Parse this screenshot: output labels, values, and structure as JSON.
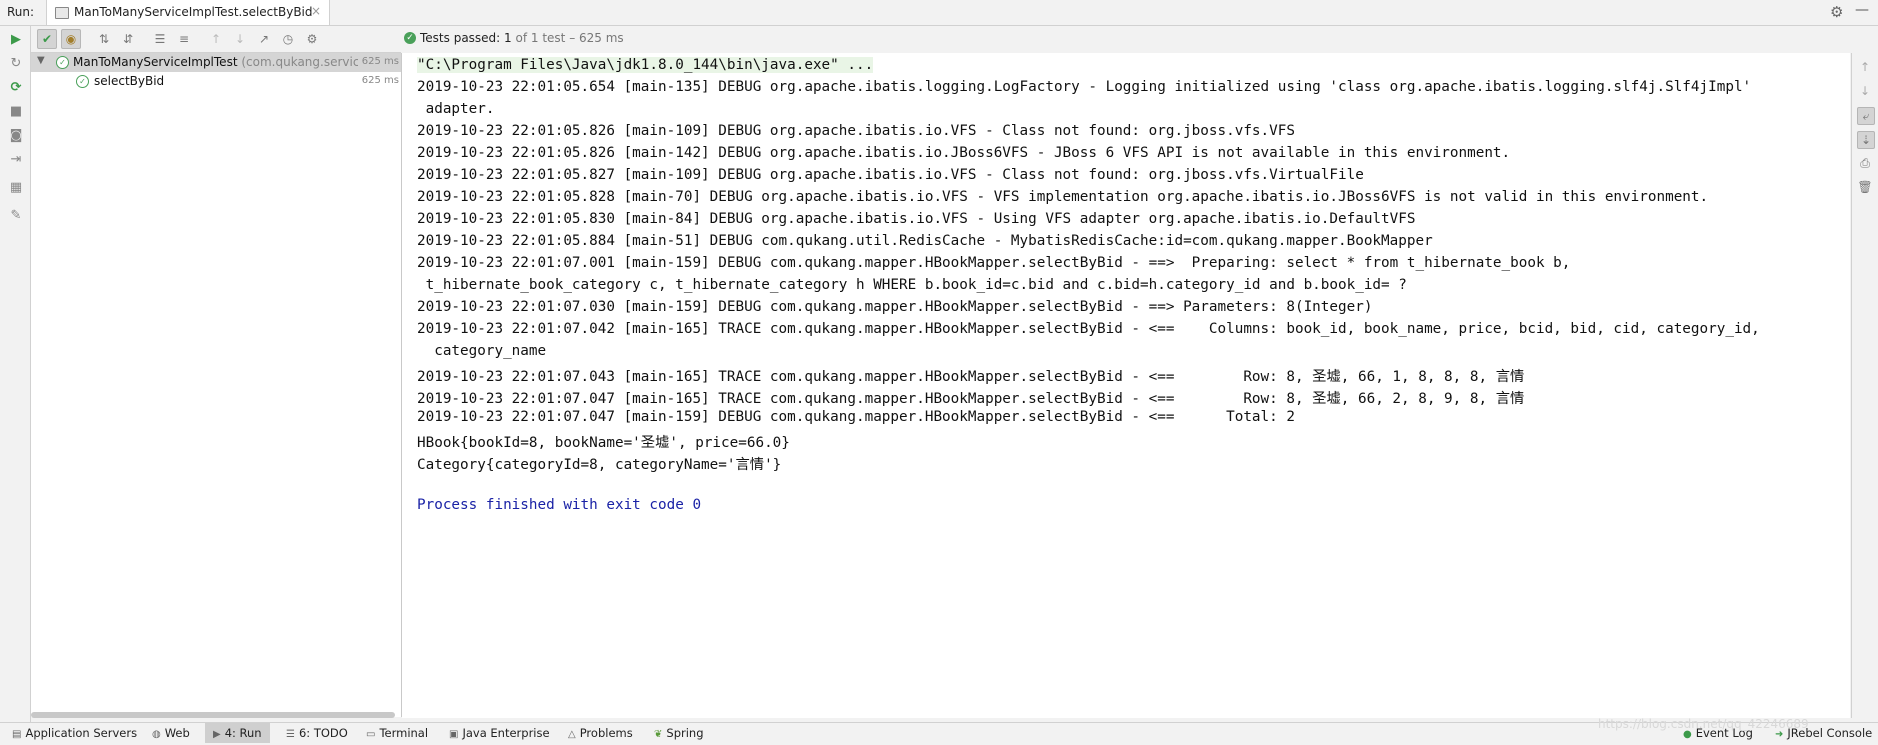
{
  "run_header": {
    "label": "Run:",
    "tab_title": "ManToManyServiceImplTest.selectByBid",
    "tab_close": "×"
  },
  "tests_status": {
    "passed_text": "Tests passed: 1",
    "detail_text": "of 1 test – 625 ms"
  },
  "tree": {
    "root": {
      "name": "ManToManyServiceImplTest",
      "package": "(com.qukang.service",
      "duration": "625 ms"
    },
    "child": {
      "name": "selectByBid",
      "duration": "625 ms"
    }
  },
  "console": {
    "lines": [
      "\"C:\\Program Files\\Java\\jdk1.8.0_144\\bin\\java.exe\" ...",
      "2019-10-23 22:01:05.654 [main-135] DEBUG org.apache.ibatis.logging.LogFactory - Logging initialized using 'class org.apache.ibatis.logging.slf4j.Slf4jImpl'",
      " adapter.",
      "2019-10-23 22:01:05.826 [main-109] DEBUG org.apache.ibatis.io.VFS - Class not found: org.jboss.vfs.VFS",
      "2019-10-23 22:01:05.826 [main-142] DEBUG org.apache.ibatis.io.JBoss6VFS - JBoss 6 VFS API is not available in this environment.",
      "2019-10-23 22:01:05.827 [main-109] DEBUG org.apache.ibatis.io.VFS - Class not found: org.jboss.vfs.VirtualFile",
      "2019-10-23 22:01:05.828 [main-70] DEBUG org.apache.ibatis.io.VFS - VFS implementation org.apache.ibatis.io.JBoss6VFS is not valid in this environment.",
      "2019-10-23 22:01:05.830 [main-84] DEBUG org.apache.ibatis.io.VFS - Using VFS adapter org.apache.ibatis.io.DefaultVFS",
      "2019-10-23 22:01:05.884 [main-51] DEBUG com.qukang.util.RedisCache - MybatisRedisCache:id=com.qukang.mapper.BookMapper",
      "2019-10-23 22:01:07.001 [main-159] DEBUG com.qukang.mapper.HBookMapper.selectByBid - ==>  Preparing: select * from t_hibernate_book b,",
      " t_hibernate_book_category c, t_hibernate_category h WHERE b.book_id=c.bid and c.bid=h.category_id and b.book_id= ?",
      "2019-10-23 22:01:07.030 [main-159] DEBUG com.qukang.mapper.HBookMapper.selectByBid - ==> Parameters: 8(Integer)",
      "2019-10-23 22:01:07.042 [main-165] TRACE com.qukang.mapper.HBookMapper.selectByBid - <==    Columns: book_id, book_name, price, bcid, bid, cid, category_id,",
      "  category_name",
      "2019-10-23 22:01:07.043 [main-165] TRACE com.qukang.mapper.HBookMapper.selectByBid - <==        Row: 8, 圣墟, 66, 1, 8, 8, 8, 言情",
      "2019-10-23 22:01:07.047 [main-165] TRACE com.qukang.mapper.HBookMapper.selectByBid - <==        Row: 8, 圣墟, 66, 2, 8, 9, 8, 言情",
      "2019-10-23 22:01:07.047 [main-159] DEBUG com.qukang.mapper.HBookMapper.selectByBid - <==      Total: 2",
      "HBook{bookId=8, bookName='圣墟', price=66.0}",
      "Category{categoryId=8, categoryName='言情'}",
      "",
      "Process finished with exit code 0"
    ]
  },
  "statusbar": {
    "items": [
      {
        "icon": "application-servers-icon",
        "label": "Application Servers"
      },
      {
        "icon": "web-icon",
        "label": "Web"
      },
      {
        "icon": "run-icon",
        "label": "4: Run"
      },
      {
        "icon": "todo-icon",
        "label": "6: TODO"
      },
      {
        "icon": "terminal-icon",
        "label": "Terminal"
      },
      {
        "icon": "java-enterprise-icon",
        "label": "Java Enterprise"
      },
      {
        "icon": "problems-icon",
        "label": "Problems"
      },
      {
        "icon": "spring-icon",
        "label": "Spring"
      }
    ],
    "event_log": "Event Log",
    "jrebel_console": "JRebel Console",
    "watermark": "https://blog.csdn.net/qq_42246689"
  },
  "colors": {
    "pass_green": "#4aa05a",
    "process_blue": "#1a22a6",
    "command_bg": "#e9f5e6"
  }
}
